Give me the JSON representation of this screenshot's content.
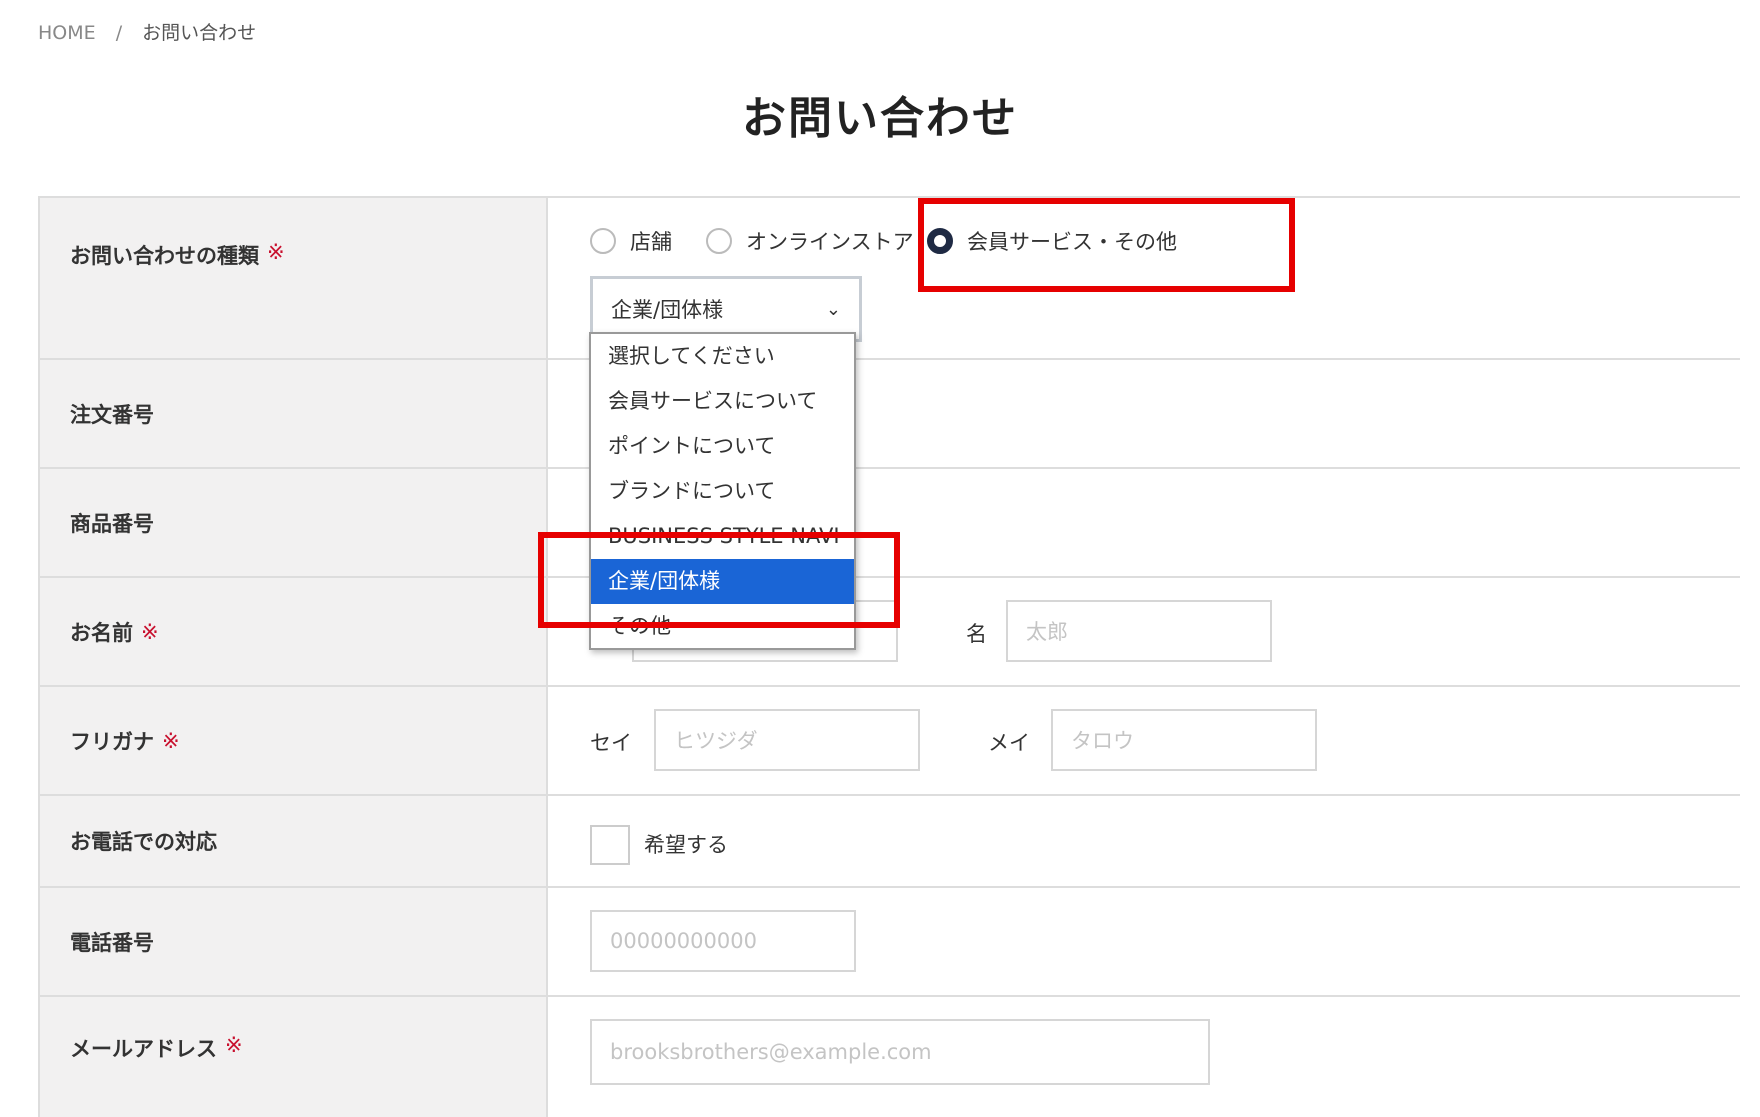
{
  "breadcrumb": {
    "home": "HOME",
    "separator": "/",
    "current": "お問い合わせ"
  },
  "page": {
    "title": "お問い合わせ"
  },
  "form": {
    "required_mark": "※",
    "inquiry_type": {
      "label": "お問い合わせの種類",
      "options": [
        "店舗",
        "オンラインストア",
        "会員サービス・その他"
      ],
      "selected_option": "会員サービス・その他",
      "select_value": "企業/団体様"
    },
    "order_number": {
      "label": "注文番号"
    },
    "product_number": {
      "label": "商品番号"
    },
    "name": {
      "label": "お名前",
      "first_label": "名",
      "first_placeholder": "太郎"
    },
    "furigana": {
      "label": "フリガナ",
      "sei_label": "セイ",
      "sei_placeholder": "ヒツジダ",
      "mei_label": "メイ",
      "mei_placeholder": "タロウ"
    },
    "phone_contact": {
      "label": "お電話での対応",
      "checkbox_label": "希望する"
    },
    "phone": {
      "label": "電話番号",
      "placeholder": "00000000000"
    },
    "email": {
      "label": "メールアドレス",
      "placeholder": "brooksbrothers@example.com"
    }
  },
  "dropdown": {
    "items": [
      "選択してください",
      "会員サービスについて",
      "ポイントについて",
      "ブランドについて",
      "BUSINESS STYLE NAVI",
      "企業/団体様",
      "その他"
    ],
    "selected": "企業/団体様"
  },
  "colors": {
    "highlight": "#e60000",
    "selected_bg": "#1a65d6",
    "required": "#c8102e"
  }
}
